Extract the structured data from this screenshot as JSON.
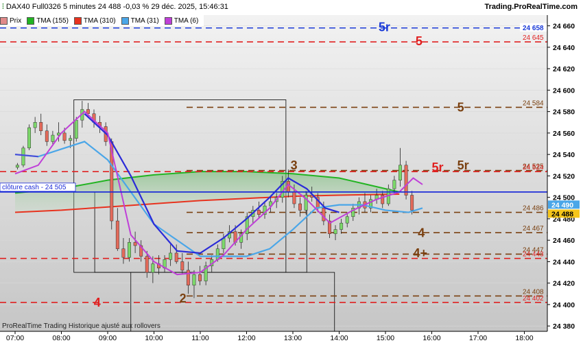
{
  "header": {
    "instrument": "DAX40 Full0326 5 minutes 24 488 -0,03 % 29 déc. 2025, 15:46:31",
    "brand": "Trading.ProRealTime.com",
    "footer": "ProRealTime Trading  Historique ajusté aux rollovers"
  },
  "legend": [
    {
      "label": "Prix",
      "color": "#e08a8a"
    },
    {
      "label": "TMA (155)",
      "color": "#22b422"
    },
    {
      "label": "TMA (310)",
      "color": "#e8321e"
    },
    {
      "label": "TMA (31)",
      "color": "#4aa6e8"
    },
    {
      "label": "TMA (6)",
      "color": "#bf3fd8"
    }
  ],
  "chart_data": {
    "type": "candlestick",
    "y_range": [
      24375,
      24670
    ],
    "x_ticks": [
      "07:00",
      "08:00",
      "09:00",
      "10:00",
      "11:00",
      "12:00",
      "13:00",
      "14:00",
      "15:00",
      "16:00",
      "17:00",
      "18:00"
    ],
    "y_ticks": [
      24380,
      24400,
      24420,
      24440,
      24460,
      24480,
      24500,
      24520,
      24540,
      24560,
      24580,
      24600,
      24620,
      24640,
      24660
    ],
    "horizontal_levels": [
      {
        "value": 24658,
        "label": "24 658",
        "color": "#1a3ad8",
        "style": "dashed"
      },
      {
        "value": 24645,
        "label": "24 645",
        "color": "#e02020",
        "style": "dashed"
      },
      {
        "value": 24584,
        "label": "24 584",
        "color": "#7a4010",
        "style": "dashed"
      },
      {
        "value": 24525,
        "label": "24 525",
        "color": "#7a4010",
        "style": "dashed"
      },
      {
        "value": 24524,
        "label": "24 524",
        "color": "#e02020",
        "style": "dashed"
      },
      {
        "value": 24505,
        "label": "clôture cash -  24 505",
        "color": "#1a2ad8",
        "style": "solid"
      },
      {
        "value": 24486,
        "label": "24 486",
        "color": "#7a4010",
        "style": "dashed"
      },
      {
        "value": 24467,
        "label": "24 467",
        "color": "#7a4010",
        "style": "dashed"
      },
      {
        "value": 24447,
        "label": "24 447",
        "color": "#7a4010",
        "style": "dashed"
      },
      {
        "value": 24443,
        "label": "24 443",
        "color": "#e02020",
        "style": "dashed"
      },
      {
        "value": 24408,
        "label": "24 408",
        "color": "#7a4010",
        "style": "dashed"
      },
      {
        "value": 24402,
        "label": "24 402",
        "color": "#e02020",
        "style": "dashed"
      }
    ],
    "current_price_labels": [
      {
        "value": 24490,
        "label": "24 490",
        "color": "#4aa6e8"
      },
      {
        "value": 24488,
        "label": "24 488",
        "color": "#f5c51a"
      }
    ],
    "annotations": [
      {
        "text": "5r",
        "color": "#1a3ad8"
      },
      {
        "text": "5",
        "color": "#e02020"
      },
      {
        "text": "5",
        "color": "#7a4010"
      },
      {
        "text": "3",
        "color": "#7a4010"
      },
      {
        "text": "5r",
        "color": "#e02020"
      },
      {
        "text": "5r",
        "color": "#7a4010"
      },
      {
        "text": "4",
        "color": "#7a4010"
      },
      {
        "text": "4+",
        "color": "#7a4010"
      },
      {
        "text": "4",
        "color": "#e02020"
      },
      {
        "text": "2",
        "color": "#7a4010"
      }
    ],
    "candles": [
      [
        24528,
        24532,
        24526,
        24530
      ],
      [
        24530,
        24548,
        24528,
        24546
      ],
      [
        24546,
        24568,
        24544,
        24565
      ],
      [
        24565,
        24575,
        24560,
        24570
      ],
      [
        24570,
        24578,
        24558,
        24562
      ],
      [
        24562,
        24568,
        24548,
        24552
      ],
      [
        24552,
        24562,
        24548,
        24558
      ],
      [
        24558,
        24570,
        24552,
        24560
      ],
      [
        24560,
        24565,
        24550,
        24553
      ],
      [
        24553,
        24558,
        24546,
        24555
      ],
      [
        24555,
        24575,
        24552,
        24572
      ],
      [
        24572,
        24590,
        24565,
        24582
      ],
      [
        24582,
        24588,
        24574,
        24578
      ],
      [
        24578,
        24582,
        24565,
        24570
      ],
      [
        24570,
        24576,
        24560,
        24566
      ],
      [
        24566,
        24570,
        24548,
        24552
      ],
      [
        24552,
        24555,
        24470,
        24478
      ],
      [
        24478,
        24490,
        24450,
        24452
      ],
      [
        24452,
        24462,
        24438,
        24444
      ],
      [
        24444,
        24462,
        24440,
        24458
      ],
      [
        24458,
        24468,
        24448,
        24455
      ],
      [
        24455,
        24460,
        24440,
        24445
      ],
      [
        24445,
        24450,
        24425,
        24430
      ],
      [
        24430,
        24445,
        24420,
        24438
      ],
      [
        24438,
        24446,
        24428,
        24434
      ],
      [
        24434,
        24446,
        24430,
        24442
      ],
      [
        24442,
        24456,
        24436,
        24448
      ],
      [
        24448,
        24456,
        24438,
        24440
      ],
      [
        24440,
        24448,
        24428,
        24432
      ],
      [
        24432,
        24440,
        24410,
        24418
      ],
      [
        24418,
        24432,
        24406,
        24428
      ],
      [
        24428,
        24436,
        24418,
        24422
      ],
      [
        24422,
        24440,
        24418,
        24436
      ],
      [
        24436,
        24446,
        24430,
        24442
      ],
      [
        24442,
        24456,
        24440,
        24452
      ],
      [
        24452,
        24466,
        24448,
        24462
      ],
      [
        24462,
        24474,
        24458,
        24468
      ],
      [
        24468,
        24474,
        24455,
        24458
      ],
      [
        24458,
        24470,
        24452,
        24466
      ],
      [
        24466,
        24486,
        24460,
        24482
      ],
      [
        24482,
        24492,
        24476,
        24488
      ],
      [
        24488,
        24496,
        24480,
        24484
      ],
      [
        24484,
        24496,
        24480,
        24492
      ],
      [
        24492,
        24500,
        24486,
        24496
      ],
      [
        24496,
        24504,
        24490,
        24500
      ],
      [
        24500,
        24520,
        24495,
        24515
      ],
      [
        24515,
        24526,
        24500,
        24505
      ],
      [
        24505,
        24512,
        24490,
        24494
      ],
      [
        24494,
        24500,
        24482,
        24488
      ],
      [
        24488,
        24506,
        24484,
        24502
      ],
      [
        24502,
        24510,
        24496,
        24500
      ],
      [
        24500,
        24504,
        24486,
        24490
      ],
      [
        24490,
        24496,
        24474,
        24478
      ],
      [
        24478,
        24484,
        24462,
        24466
      ],
      [
        24466,
        24474,
        24460,
        24470
      ],
      [
        24470,
        24480,
        24466,
        24476
      ],
      [
        24476,
        24486,
        24472,
        24482
      ],
      [
        24482,
        24494,
        24478,
        24490
      ],
      [
        24490,
        24500,
        24484,
        24496
      ],
      [
        24496,
        24504,
        24486,
        24490
      ],
      [
        24490,
        24502,
        24486,
        24498
      ],
      [
        24498,
        24508,
        24494,
        24502
      ],
      [
        24502,
        24506,
        24490,
        24494
      ],
      [
        24494,
        24512,
        24492,
        24508
      ],
      [
        24508,
        24520,
        24504,
        24516
      ],
      [
        24516,
        24546,
        24510,
        24530
      ],
      [
        24530,
        24534,
        24498,
        24502
      ],
      [
        24502,
        24506,
        24484,
        24488
      ]
    ]
  }
}
